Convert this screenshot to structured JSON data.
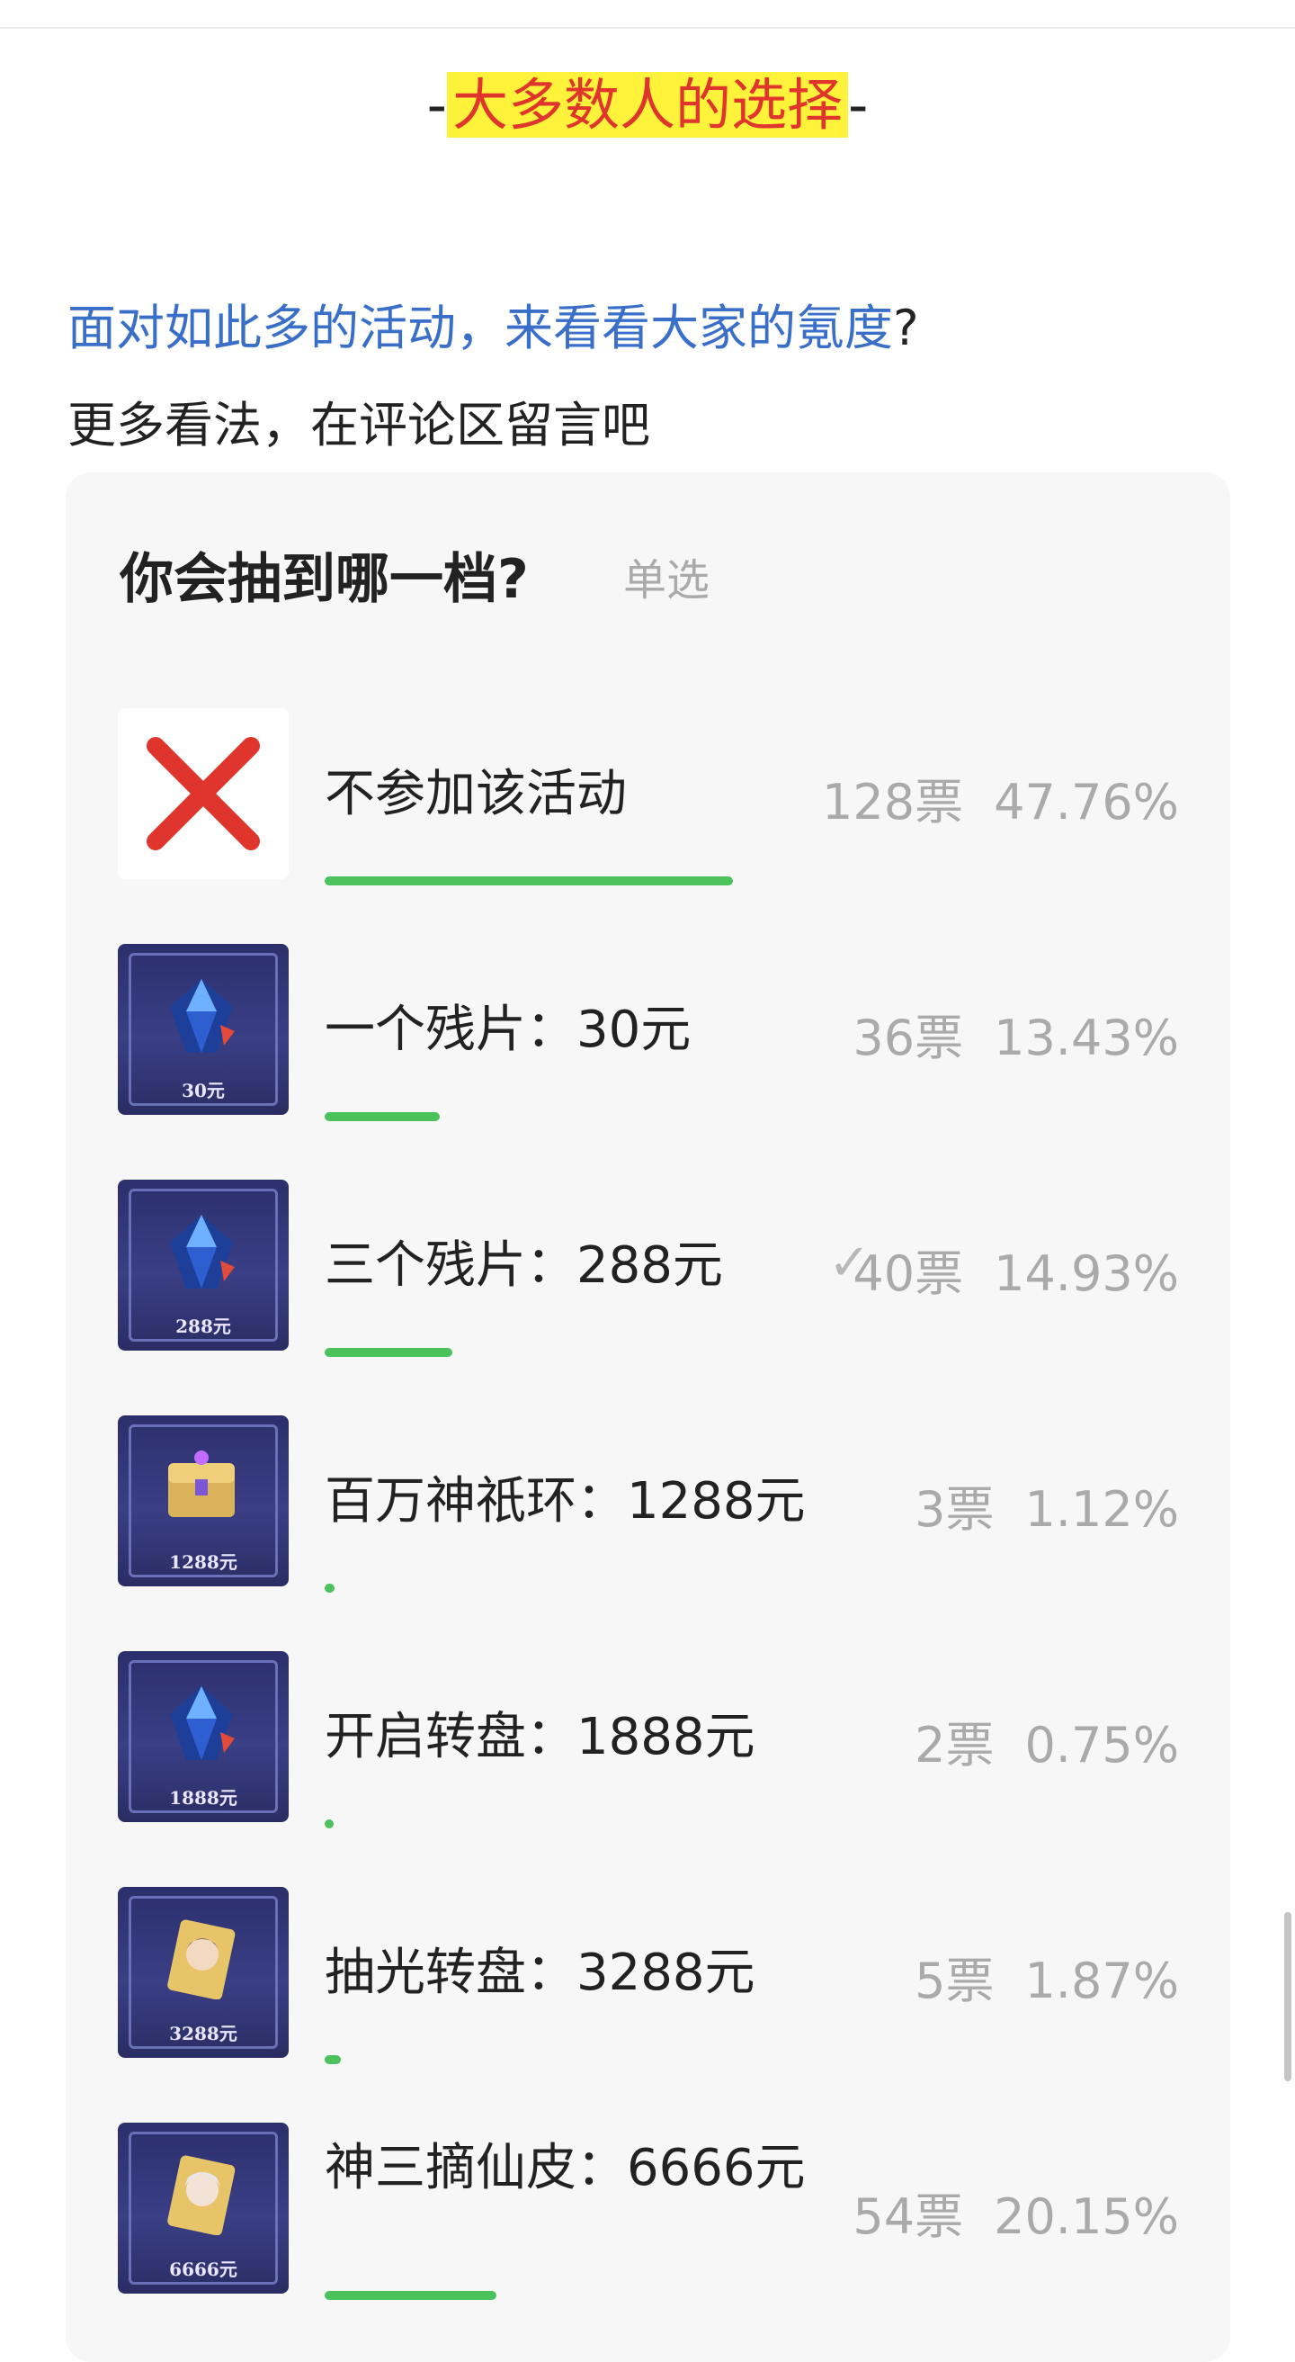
{
  "header": {
    "dash_left": "-",
    "title": "大多数人的选择",
    "dash_right": "-"
  },
  "intro": {
    "line1": "面对如此多的活动，来看看大家的氪度",
    "line1_end": "?",
    "line2": "更多看法，在评论区留言吧"
  },
  "poll": {
    "title": "你会抽到哪一档?",
    "type": "单选",
    "options": [
      {
        "label": "不参加该活动",
        "votes": "128票",
        "percent": "47.76%",
        "share": 0.4776,
        "icon": "red-x-icon",
        "price_tag": ""
      },
      {
        "label": "一个残片：30元",
        "votes": "36票",
        "percent": "13.43%",
        "share": 0.1343,
        "icon": "crystal-fragment-card",
        "price_tag": "30元"
      },
      {
        "label": "三个残片：288元",
        "votes": "40票",
        "percent": "14.93%",
        "share": 0.1493,
        "icon": "crystal-fragment-card",
        "price_tag": "288元",
        "selected": true
      },
      {
        "label": "百万神祇环：1288元",
        "votes": "3票",
        "percent": "1.12%",
        "share": 0.0112,
        "icon": "treasure-chest-card",
        "price_tag": "1288元"
      },
      {
        "label": "开启转盘：1888元",
        "votes": "2票",
        "percent": "0.75%",
        "share": 0.0075,
        "icon": "crystal-fragment-card",
        "price_tag": "1888元"
      },
      {
        "label": "抽光转盘：3288元",
        "votes": "5票",
        "percent": "1.87%",
        "share": 0.0187,
        "icon": "hero-skin-card",
        "price_tag": "3288元"
      },
      {
        "label": "神三摘仙皮：6666元",
        "votes": "54票",
        "percent": "20.15%",
        "share": 0.2015,
        "icon": "hero-skin-card",
        "price_tag": "6666元"
      }
    ]
  },
  "colors": {
    "accent_blue": "#3a6fc9",
    "highlight": "#fff23a",
    "title_red": "#e0352d",
    "bar_green": "#4cc25c"
  }
}
